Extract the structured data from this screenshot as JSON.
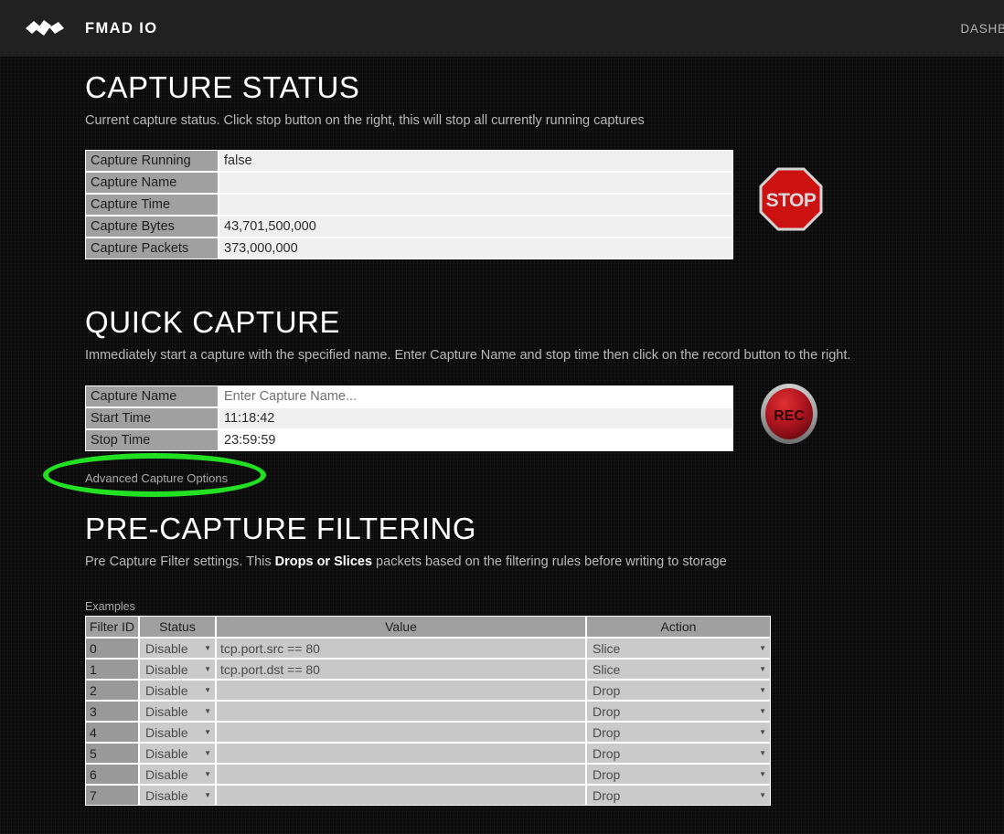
{
  "header": {
    "brand": "FMAD IO",
    "logo_icon": "fmad-blades-logo",
    "nav_items": [
      {
        "label": "DASHBOA"
      }
    ]
  },
  "capture_status": {
    "title": "CAPTURE STATUS",
    "subtitle": "Current capture status. Click stop button on the right, this will stop all currently running captures",
    "rows": [
      {
        "label": "Capture Running",
        "value": "false"
      },
      {
        "label": "Capture Name",
        "value": ""
      },
      {
        "label": "Capture Time",
        "value": ""
      },
      {
        "label": "Capture Bytes",
        "value": "43,701,500,000"
      },
      {
        "label": "Capture Packets",
        "value": "373,000,000"
      }
    ],
    "stop_button": {
      "label": "STOP",
      "icon": "stop-sign-icon",
      "fill": "#cc1111",
      "stroke": "#cfcfcf"
    }
  },
  "quick_capture": {
    "title": "QUICK CAPTURE",
    "subtitle": "Immediately start a capture with the specified name. Enter Capture Name and stop time then click on the record button to the right.",
    "rows": [
      {
        "label": "Capture Name",
        "value": "Enter Capture Name...",
        "is_placeholder": true
      },
      {
        "label": "Start Time",
        "value": "11:18:42",
        "is_placeholder": false
      },
      {
        "label": "Stop Time",
        "value": "23:59:59",
        "is_placeholder": false
      }
    ],
    "record_button": {
      "label": "REC",
      "icon": "record-button-icon",
      "fill": "#b01520",
      "ring": "#a8a8a8"
    },
    "advanced_link": "Advanced Capture Options",
    "annotation_color": "#22e022"
  },
  "pre_capture_filtering": {
    "title": "PRE-CAPTURE FILTERING",
    "subtitle_before": "Pre Capture Filter settings. This ",
    "subtitle_bold": "Drops or Slices",
    "subtitle_after": " packets based on the filtering rules before writing to storage",
    "examples_label": "Examples",
    "columns": [
      "Filter ID",
      "Status",
      "Value",
      "Action"
    ],
    "rows": [
      {
        "id": "0",
        "status": "Disable",
        "value": "tcp.port.src == 80",
        "action": "Slice"
      },
      {
        "id": "1",
        "status": "Disable",
        "value": "tcp.port.dst == 80",
        "action": "Slice"
      },
      {
        "id": "2",
        "status": "Disable",
        "value": "",
        "action": "Drop"
      },
      {
        "id": "3",
        "status": "Disable",
        "value": "",
        "action": "Drop"
      },
      {
        "id": "4",
        "status": "Disable",
        "value": "",
        "action": "Drop"
      },
      {
        "id": "5",
        "status": "Disable",
        "value": "",
        "action": "Drop"
      },
      {
        "id": "6",
        "status": "Disable",
        "value": "",
        "action": "Drop"
      },
      {
        "id": "7",
        "status": "Disable",
        "value": "",
        "action": "Drop"
      }
    ],
    "caret_glyph": "▼"
  }
}
